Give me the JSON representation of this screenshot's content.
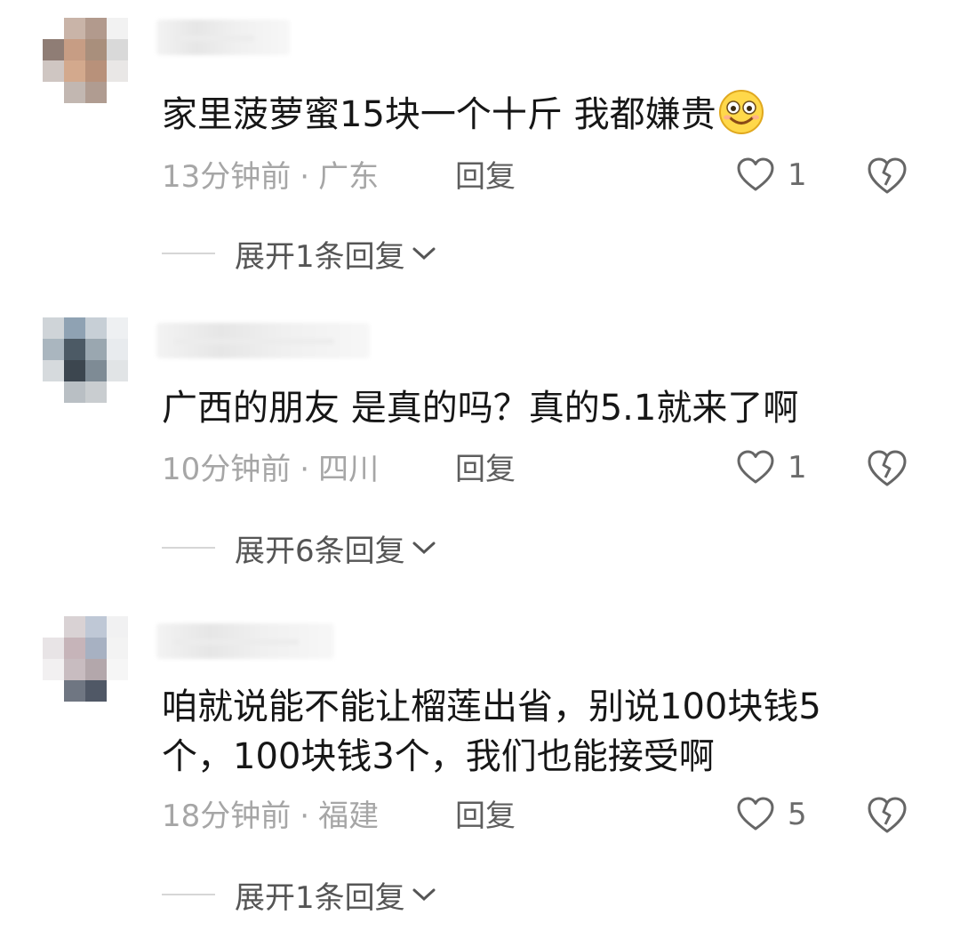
{
  "comments": [
    {
      "text": "家里菠萝蜜15块一个十斤 我都嫌贵",
      "emoji": "smile-emoji",
      "time": "13分钟前",
      "location": "广东",
      "reply": "回复",
      "likes": "1",
      "expand": "展开1条回复"
    },
    {
      "text": "广西的朋友 是真的吗？真的5.1就来了啊",
      "time": "10分钟前",
      "location": "四川",
      "reply": "回复",
      "likes": "1",
      "expand": "展开6条回复"
    },
    {
      "text": "咱就说能不能让榴莲出省，别说100块钱5\n个，100块钱3个，我们也能接受啊",
      "time": "18分钟前",
      "location": "福建",
      "reply": "回复",
      "likes": "5",
      "expand": "展开1条回复"
    }
  ],
  "meta_separator": "·",
  "icons": {
    "like": "heart-outline-icon",
    "dislike": "broken-heart-icon",
    "expand": "chevron-down-icon"
  },
  "colors": {
    "text": "#161616",
    "meta": "#a6a6a6",
    "reply": "#5e5e5e",
    "icon": "#6b6b6b"
  }
}
